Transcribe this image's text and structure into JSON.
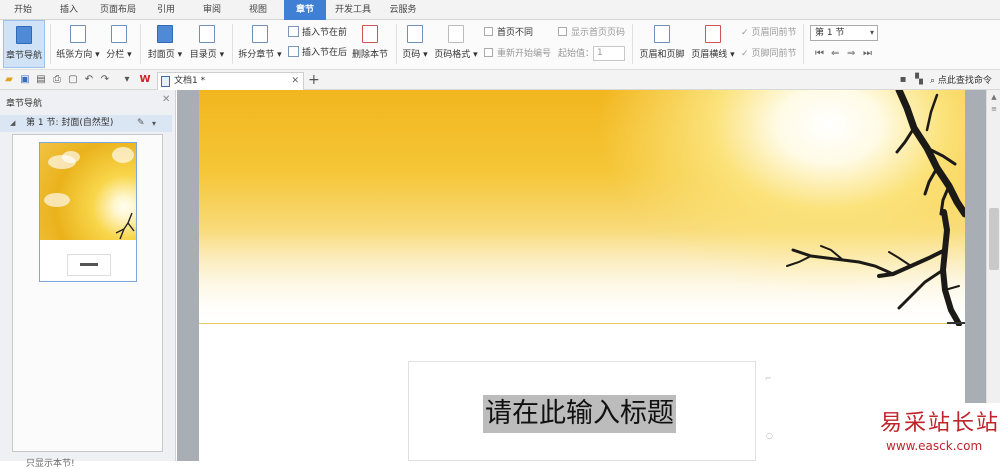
{
  "menu_tabs": [
    "开始",
    "插入",
    "页面布局",
    "引用",
    "审阅",
    "视图",
    "章节",
    "开发工具",
    "云服务"
  ],
  "active_tab": "章节",
  "ribbon": {
    "chapter_nav": "章节导航",
    "paper_direction": "纸张方向",
    "columns": "分栏",
    "cover": "封面页",
    "toc": "目录页",
    "split_section": "拆分章节",
    "insert_before": "插入节在前",
    "insert_after": "插入节在后",
    "delete_section": "删除本节",
    "page_number": "页码",
    "page_number_format": "页码格式",
    "first_page_diff": "首页不同",
    "show_first_page_number": "显示首页页码",
    "restart_numbering": "重新开始编号",
    "start_value_label": "起始值：",
    "start_value": "1",
    "header_footer": "页眉和页脚",
    "header_line": "页眉横线",
    "header_same_as_prev": "页眉同前节",
    "footer_same_as_prev": "页脚同前节",
    "section_select": "第 1 节"
  },
  "quickbar": {
    "doc_tab": "文档1 *",
    "search_label": "点此查找命令"
  },
  "panel": {
    "title": "章节导航",
    "section_label": "第 1 节: 封面(自然型)",
    "footer": "只显示本节!"
  },
  "document": {
    "title_placeholder": "请在此输入标题"
  },
  "watermark": {
    "name": "易采站长站",
    "url": "www.easck.com"
  },
  "colors": {
    "accent": "#3f7fd4",
    "watermark": "#c0242b"
  }
}
